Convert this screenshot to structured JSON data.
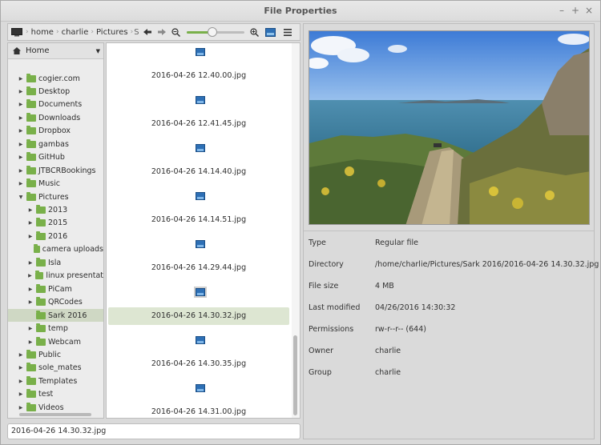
{
  "window": {
    "title": "File Properties"
  },
  "toolbar": {
    "breadcrumbs": [
      "home",
      "charlie",
      "Pictures",
      "S"
    ],
    "zoom_level": 0.45
  },
  "tree": {
    "header": "Home",
    "items": [
      {
        "label": "cogier.com",
        "depth": 0,
        "expandable": true
      },
      {
        "label": "Desktop",
        "depth": 0,
        "expandable": true
      },
      {
        "label": "Documents",
        "depth": 0,
        "expandable": true
      },
      {
        "label": "Downloads",
        "depth": 0,
        "expandable": true
      },
      {
        "label": "Dropbox",
        "depth": 0,
        "expandable": true
      },
      {
        "label": "gambas",
        "depth": 0,
        "expandable": true
      },
      {
        "label": "GitHub",
        "depth": 0,
        "expandable": true
      },
      {
        "label": "JTBCRBookings",
        "depth": 0,
        "expandable": true
      },
      {
        "label": "Music",
        "depth": 0,
        "expandable": true
      },
      {
        "label": "Pictures",
        "depth": 0,
        "expandable": true,
        "expanded": true
      },
      {
        "label": "2013",
        "depth": 1,
        "expandable": true
      },
      {
        "label": "2015",
        "depth": 1,
        "expandable": true
      },
      {
        "label": "2016",
        "depth": 1,
        "expandable": true
      },
      {
        "label": "camera uploads",
        "depth": 1,
        "expandable": false
      },
      {
        "label": "Isla",
        "depth": 1,
        "expandable": true
      },
      {
        "label": "linux presentat",
        "depth": 1,
        "expandable": true
      },
      {
        "label": "PiCam",
        "depth": 1,
        "expandable": true
      },
      {
        "label": "QRCodes",
        "depth": 1,
        "expandable": true
      },
      {
        "label": "Sark 2016",
        "depth": 1,
        "expandable": false,
        "selected": true
      },
      {
        "label": "temp",
        "depth": 1,
        "expandable": true
      },
      {
        "label": "Webcam",
        "depth": 1,
        "expandable": true
      },
      {
        "label": "Public",
        "depth": 0,
        "expandable": true
      },
      {
        "label": "sole_mates",
        "depth": 0,
        "expandable": true
      },
      {
        "label": "Templates",
        "depth": 0,
        "expandable": true
      },
      {
        "label": "test",
        "depth": 0,
        "expandable": true
      },
      {
        "label": "Videos",
        "depth": 0,
        "expandable": true
      }
    ]
  },
  "files": [
    {
      "name": "2016-04-26 12.40.00.jpg"
    },
    {
      "name": "2016-04-26 12.41.45.jpg"
    },
    {
      "name": "2016-04-26 14.14.40.jpg"
    },
    {
      "name": "2016-04-26 14.14.51.jpg"
    },
    {
      "name": "2016-04-26 14.29.44.jpg"
    },
    {
      "name": "2016-04-26 14.30.32.jpg",
      "selected": true
    },
    {
      "name": "2016-04-26 14.30.35.jpg"
    },
    {
      "name": "2016-04-26 14.31.00.jpg"
    }
  ],
  "namebar": {
    "value": "2016-04-26 14.30.32.jpg"
  },
  "properties": [
    {
      "label": "Type",
      "value": "Regular file"
    },
    {
      "label": "Directory",
      "value": "/home/charlie/Pictures/Sark 2016/2016-04-26 14.30.32.jpg"
    },
    {
      "label": "File size",
      "value": "4 MB"
    },
    {
      "label": "Last modified",
      "value": "04/26/2016 14:30:32"
    },
    {
      "label": "Permissions",
      "value": "rw-r--r-- (644)"
    },
    {
      "label": "Owner",
      "value": "charlie"
    },
    {
      "label": "Group",
      "value": "charlie"
    }
  ],
  "colors": {
    "accent_selection": "#cfd8c4",
    "folder": "#79b04a"
  }
}
